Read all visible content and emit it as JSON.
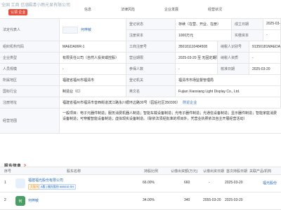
{
  "header": {
    "logo_text": "全国 工商 信息",
    "company_title": "福清小雨光显有限公司",
    "claim_badge": "认领 企业",
    "tabs": [
      "信息",
      "法律风险",
      "企业发展",
      "经营状况"
    ]
  },
  "info": {
    "legal_rep_label": "法定代表人",
    "legal_rep_name": "何梓敏",
    "reg_status_label": "登记状态",
    "reg_status_value": "存续（在营、开业、在册）",
    "establish_date_label": "成立日期",
    "establish_date_value": "2025-03-20",
    "reg_capital_label": "注册资本",
    "reg_capital_value": "1000万元",
    "paid_capital_label": "实缴资本",
    "paid_capital_value": "-",
    "org_code_label": "组织机构代码",
    "org_code_value": "MAEDA06R-1",
    "biz_reg_label": "工商注册号",
    "biz_reg_value": "350181110484508",
    "tax_id_label": "纳税人识别号",
    "tax_id_value": "91350181MAEDA06R1X",
    "company_type_label": "企业类型",
    "company_type_value": "有限责任公司（自然人投资或控股）",
    "term_label": "营业期限",
    "term_value": "2025-03-20 至 无固定期限",
    "taxpayer_qual_label": "纳税人资质",
    "taxpayer_qual_value": "-",
    "staff_label": "人员规模",
    "staff_value": "-",
    "insured_label": "参保人数",
    "insured_value": "-",
    "approve_date_label": "核准日期",
    "approve_date_value": "2025-03-20",
    "region_label": "所属地区",
    "region_value": "福建省福州市福清市",
    "authority_label": "登记机关",
    "authority_value": "福清市市场监督管理局",
    "industry_label": "国标行业",
    "industry_value": "制造业（C）",
    "english_name_label": "英文名",
    "english_name_value": "Fujian Xiaoxiang Light Display Co., Ltd.",
    "address_label": "注册地址",
    "address_value": "福建省福州市福清市音西街道滨江路永川循环边路30号（园后社区350300）",
    "address_link": "附近企业",
    "scope_label": "经营范围",
    "scope_value": "一般项目：电子元器件制造；服务消费机器人制造；智能车载设备制造；光电子器件制造；光通信设备制造；显示器件制造；智能家庭消费设备制造；可穿戴智能设备制造；虚拟现实设备制造。（除依法须经批准的项目外，凭营业执照依法自主开展经营活动）"
  },
  "shareholders": {
    "title": "股东信息",
    "count": "2",
    "headers": [
      "序号",
      "股东名称",
      "持股比例",
      "认缴出资额(万元)",
      "认缴出资日期",
      "首次持股日期",
      "关联产品/机构"
    ],
    "rows": [
      {
        "index": "1",
        "name": "福建福光股份有限公司",
        "tag1": "大股东",
        "tag2": "A股 | 福光股份 688010.SH",
        "ratio": "66.00%",
        "amount": "660",
        "sub_date": "-",
        "first_date": "2025-03-20",
        "product": "福光股份"
      },
      {
        "index": "2",
        "name": "何梓敏",
        "avatar_text": "何",
        "ratio": "34.00%",
        "amount": "340",
        "sub_date": "2055-03-20",
        "first_date": "2025-03-20",
        "product": ""
      }
    ]
  }
}
